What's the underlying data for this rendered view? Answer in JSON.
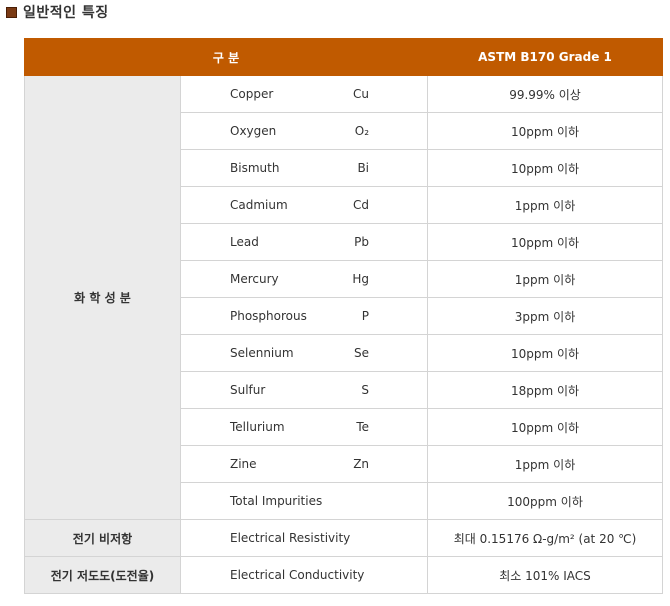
{
  "page": {
    "title": "일반적인 특징"
  },
  "table": {
    "header": {
      "col1": "구 분",
      "col2": "ASTM B170 Grade 1"
    },
    "chem": {
      "category": "화 학 성 분",
      "rows": [
        {
          "element": "Copper",
          "symbol": "Cu",
          "value": "99.99% 이상"
        },
        {
          "element": "Oxygen",
          "symbol": "O₂",
          "value": "10ppm 이하"
        },
        {
          "element": "Bismuth",
          "symbol": "Bi",
          "value": "10ppm 이하"
        },
        {
          "element": "Cadmium",
          "symbol": "Cd",
          "value": "1ppm 이하"
        },
        {
          "element": "Lead",
          "symbol": "Pb",
          "value": "10ppm 이하"
        },
        {
          "element": "Mercury",
          "symbol": "Hg",
          "value": "1ppm 이하"
        },
        {
          "element": "Phosphorous",
          "symbol": "P",
          "value": "3ppm 이하"
        },
        {
          "element": "Selennium",
          "symbol": "Se",
          "value": "10ppm 이하"
        },
        {
          "element": "Sulfur",
          "symbol": "S",
          "value": "18ppm 이하"
        },
        {
          "element": "Tellurium",
          "symbol": "Te",
          "value": "10ppm 이하"
        },
        {
          "element": "Zine",
          "symbol": "Zn",
          "value": "1ppm 이하"
        },
        {
          "element": "Total Impurities",
          "symbol": "",
          "value": "100ppm 이하"
        }
      ]
    },
    "resistivity": {
      "category": "전기 비저항",
      "item": "Electrical Resistivity",
      "value": "최대 0.15176 Ω-g/m² (at 20 ℃)"
    },
    "conductivity": {
      "category": "전기 저도도(도전율)",
      "item": "Electrical Conductivity",
      "value": "최소 101% IACS"
    }
  },
  "colors": {
    "header_bg": "#c05a00",
    "category_bg": "#ebebeb",
    "bullet": "#7a3a14"
  }
}
